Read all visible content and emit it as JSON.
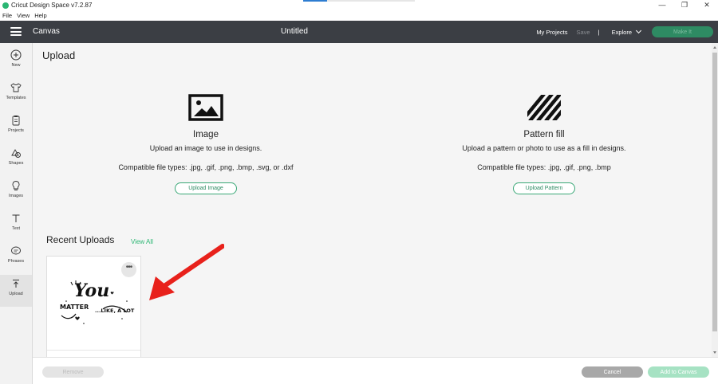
{
  "window": {
    "title": "Cricut Design Space  v7.2.87",
    "controls": [
      "—",
      "❐",
      "✕"
    ]
  },
  "menu": [
    "File",
    "View",
    "Help"
  ],
  "header": {
    "canvas_label": "Canvas",
    "doc_title": "Untitled",
    "my_projects": "My Projects",
    "save": "Save",
    "separator": "|",
    "explore": "Explore",
    "make_it": "Make It"
  },
  "sidebar": {
    "items": [
      {
        "label": "New",
        "icon": "plus-circle-icon"
      },
      {
        "label": "Templates",
        "icon": "tshirt-icon"
      },
      {
        "label": "Projects",
        "icon": "clipboard-icon"
      },
      {
        "label": "Shapes",
        "icon": "shapes-icon"
      },
      {
        "label": "Images",
        "icon": "lightbulb-icon"
      },
      {
        "label": "Text",
        "icon": "text-icon"
      },
      {
        "label": "Phrases",
        "icon": "speech-bubble-icon"
      },
      {
        "label": "Upload",
        "icon": "upload-icon"
      }
    ],
    "active": "Upload"
  },
  "upload": {
    "title": "Upload",
    "image": {
      "heading": "Image",
      "description": "Upload an image to use in designs.",
      "types": "Compatible file types: .jpg, .gif, .png, .bmp, .svg, or .dxf",
      "button": "Upload Image"
    },
    "pattern": {
      "heading": "Pattern fill",
      "description": "Upload a pattern or photo to use as a fill in designs.",
      "types": "Compatible file types: .jpg, .gif, .png, .bmp",
      "button": "Upload Pattern"
    },
    "recent_title": "Recent Uploads",
    "view_all": "View All",
    "recent_items": [
      {
        "art_text_1": "You",
        "art_text_2": "MATTER",
        "art_text_3": "...LIKE, A LOT!",
        "menu": "•••"
      }
    ]
  },
  "footer": {
    "remove": "Remove",
    "cancel": "Cancel",
    "add_to_canvas": "Add to Canvas"
  },
  "colors": {
    "header_bg": "#3b3e44",
    "accent": "#2bb673",
    "arrow": "#e8211b"
  }
}
